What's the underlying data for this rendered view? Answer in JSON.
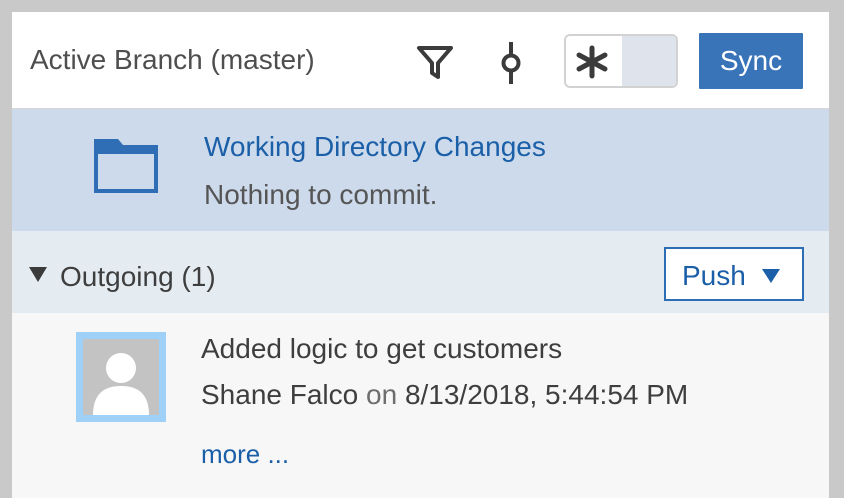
{
  "header": {
    "title": "Active Branch (master)",
    "filter_icon": "filter-icon",
    "commit_icon": "git-commit-icon",
    "toggle_icon": "asterisk-icon",
    "sync_label": "Sync"
  },
  "working_directory": {
    "icon": "folder-icon",
    "title": "Working Directory Changes",
    "status": "Nothing to commit."
  },
  "outgoing": {
    "label": "Outgoing (1)",
    "expanded": true,
    "push_label": "Push",
    "commits": [
      {
        "message": "Added logic to get customers",
        "author": "Shane Falco",
        "on_text": "on",
        "date": "8/13/2018, 5:44:54 PM",
        "more_label": "more ..."
      }
    ]
  },
  "colors": {
    "accent": "#3a74b8",
    "link": "#1b5fa8",
    "working_dir_bg": "#ccdaeb",
    "section_bg": "#e4ecf2"
  }
}
